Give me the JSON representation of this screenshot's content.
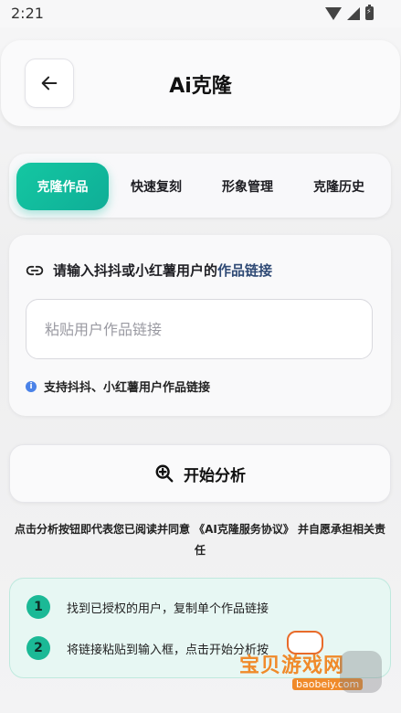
{
  "status_bar": {
    "time": "2:21"
  },
  "header": {
    "title": "Ai克隆"
  },
  "tabs": [
    {
      "label": "克隆作品",
      "active": true
    },
    {
      "label": "快速复刻",
      "active": false
    },
    {
      "label": "形象管理",
      "active": false
    },
    {
      "label": "克隆历史",
      "active": false
    }
  ],
  "input_card": {
    "heading_prefix": "请输入抖抖或小红薯用户的",
    "heading_highlight": "作品链接",
    "placeholder": "粘贴用户作品链接",
    "value": "",
    "hint": "支持抖抖、小红薯用户作品链接"
  },
  "analyze_button": {
    "label": "开始分析"
  },
  "agreement": {
    "text": "点击分析按钮即代表您已阅读并同意 《AI克隆服务协议》 并自愿承担相关责任"
  },
  "steps": [
    {
      "num": "1",
      "text": "找到已授权的用户，复制单个作品链接"
    },
    {
      "num": "2",
      "text": "将链接粘贴到输入框，点击开始分析按"
    }
  ],
  "watermark": {
    "text": "宝贝游戏网",
    "url": "baobeiy.com"
  },
  "colors": {
    "accent": "#14c7a2",
    "info": "#4a82e8",
    "step_bg": "#e7f7f3"
  }
}
